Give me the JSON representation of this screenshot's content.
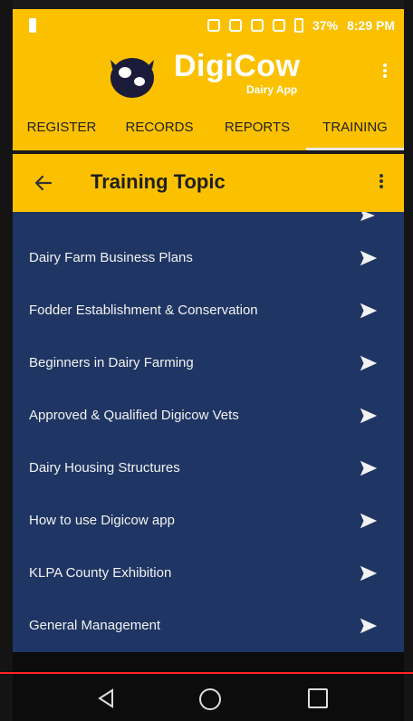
{
  "status_bar": {
    "battery_percent": "37%",
    "time": "8:29 PM"
  },
  "app": {
    "name": "DigiCow",
    "subtitle": "Dairy App",
    "logo_icon": "cow-logo-icon"
  },
  "tabs": [
    {
      "label": "REGISTER"
    },
    {
      "label": "RECORDS"
    },
    {
      "label": "REPORTS"
    },
    {
      "label": "TRAINING",
      "active": true
    }
  ],
  "toolbar": {
    "title": "Training Topic",
    "back_icon": "arrow-back-icon",
    "menu_icon": "more-vert-icon"
  },
  "topics": [
    {
      "label": "Dairy Farm Business Plans"
    },
    {
      "label": "Fodder Establishment & Conservation"
    },
    {
      "label": "Beginners in Dairy Farming"
    },
    {
      "label": "Approved & Qualified Digicow Vets"
    },
    {
      "label": "Dairy Housing Structures"
    },
    {
      "label": "How to use Digicow app"
    },
    {
      "label": "KLPA County Exhibition"
    },
    {
      "label": "General Management"
    }
  ],
  "colors": {
    "accent": "#fbc100",
    "list_bg": "#1f3563",
    "text_light": "#f2f2f2"
  }
}
